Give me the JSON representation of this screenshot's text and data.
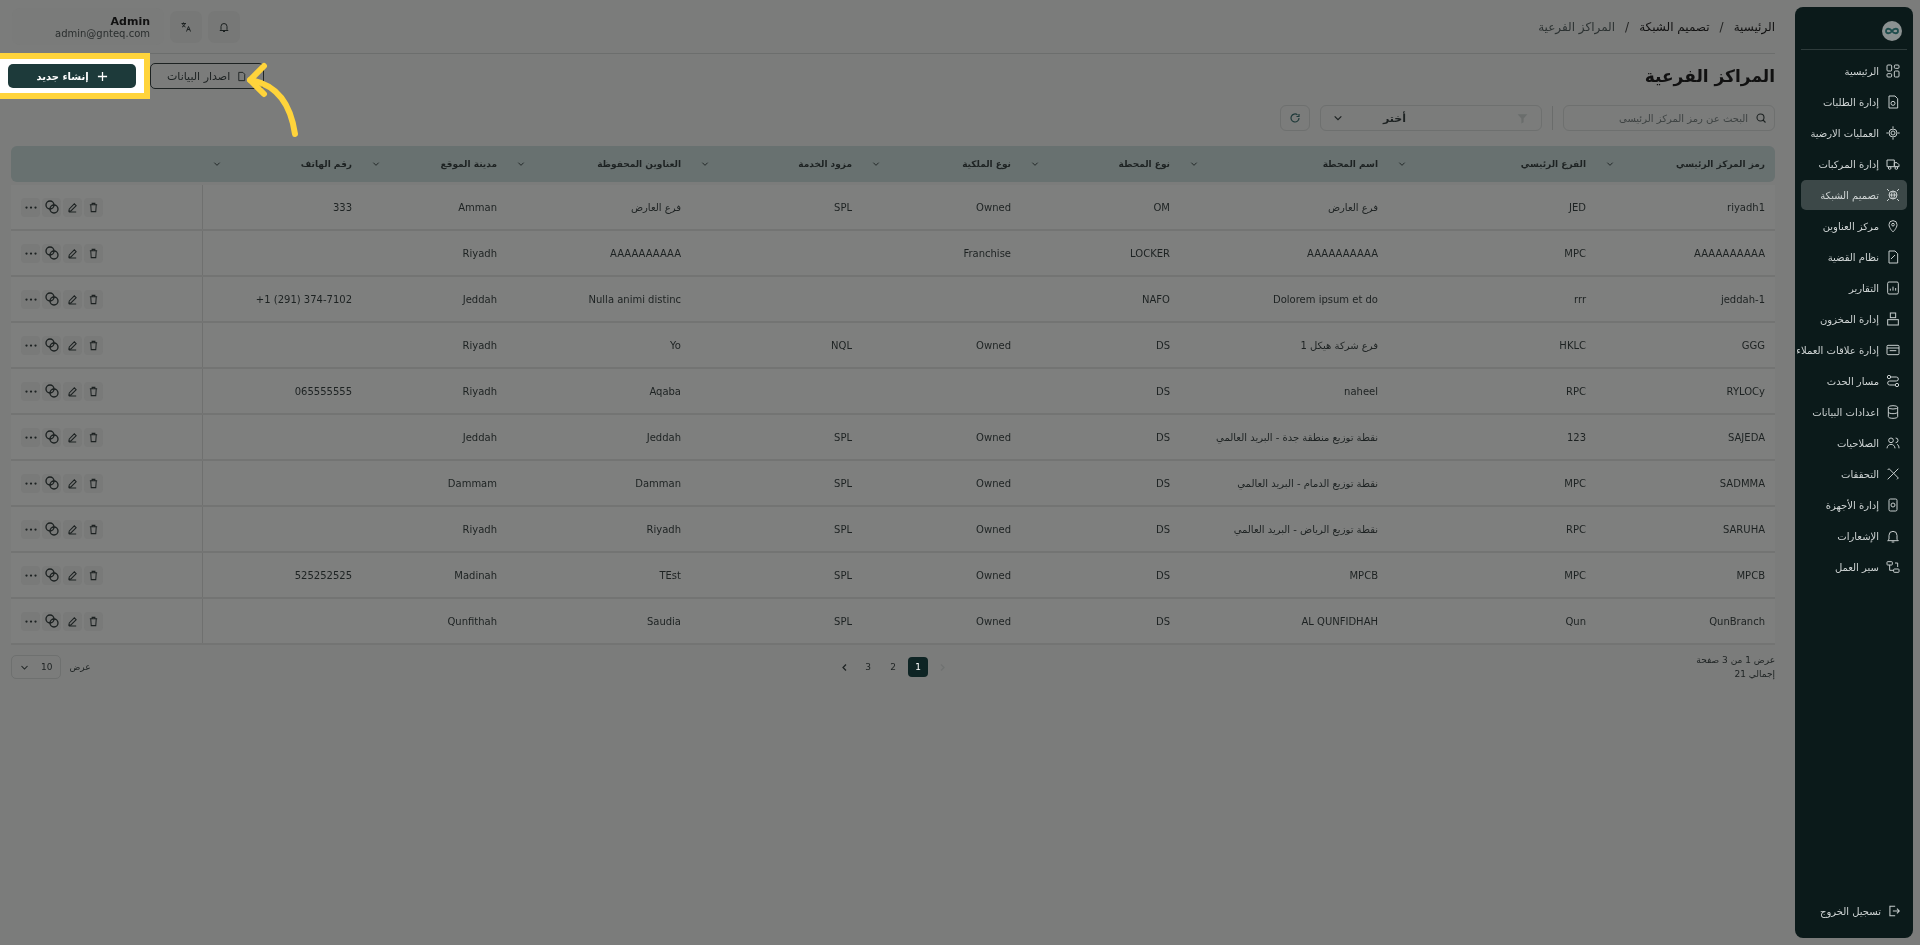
{
  "sidebar": {
    "items": [
      {
        "label": "الرئيسية",
        "selected": false
      },
      {
        "label": "إدارة الطلبات",
        "selected": false
      },
      {
        "label": "العمليات الارضية",
        "selected": false
      },
      {
        "label": "إدارة المركبات",
        "selected": false
      },
      {
        "label": "تصميم الشبكة",
        "selected": true
      },
      {
        "label": "مركز العناوين",
        "selected": false
      },
      {
        "label": "نظام القضية",
        "selected": false
      },
      {
        "label": "التقارير",
        "selected": false
      },
      {
        "label": "إدارة المخزون",
        "selected": false
      },
      {
        "label": "إدارة علاقات العملاء",
        "selected": false
      },
      {
        "label": "مسار الحدث",
        "selected": false
      },
      {
        "label": "اعدادات البيانات",
        "selected": false
      },
      {
        "label": "الصلاحيات",
        "selected": false
      },
      {
        "label": "التحققات",
        "selected": false
      },
      {
        "label": "إدارة الأجهزة",
        "selected": false
      },
      {
        "label": "الإشعارات",
        "selected": false
      },
      {
        "label": "سير العمل",
        "selected": false
      }
    ],
    "logout": "تسجيل الخروج"
  },
  "header": {
    "breadcrumb": [
      {
        "kind": "link",
        "label": "الرئيسية"
      },
      {
        "kind": "separator",
        "label": "/"
      },
      {
        "kind": "link",
        "label": "تصميم الشبكة"
      },
      {
        "kind": "separator",
        "label": "/"
      },
      {
        "kind": "current",
        "label": "المراكز الفرعية"
      }
    ],
    "user": {
      "name": "Admin",
      "email": "admin@gnteq.com"
    }
  },
  "page": {
    "title": "المراكز الفرعية",
    "export_button": "اصدار البيانات",
    "create_button": "إنشاء جديد",
    "search": {
      "placeholder": "البحث عن رمز المركز الرئيسي"
    },
    "filter": {
      "value": "أختر"
    }
  },
  "tutorial": {
    "spotlight": true
  },
  "table": {
    "columns": [
      "رمز المركز الرئيسي",
      "الفرع الرئيسي",
      "اسم المحطة",
      "نوع المحطة",
      "نوع الملكية",
      "مزود الخدمة",
      "العناوين المحفوظة",
      "مدينة الموقع",
      "رقم الهاتف"
    ],
    "rows": [
      {
        "code": "riyadh1",
        "branch": "JED",
        "station": "فرع العارض",
        "type": "OM",
        "ownership": "Owned",
        "provider": "SPL",
        "address": "فرع العارض",
        "city": "Amman",
        "phone": "333"
      },
      {
        "code": "AAAAAAAAAA",
        "branch": "MPC",
        "station": "AAAAAAAAAA",
        "type": "LOCKER",
        "ownership": "Franchise",
        "address": "AAAAAAAAAA",
        "city": "Riyadh"
      },
      {
        "code": "jeddah-1",
        "branch": "rrr",
        "station": "Dolorem ipsum et do",
        "type": "NAFO",
        "address": "Nulla animi distinc",
        "city": "Jeddah",
        "phone": "+1 (291) 374-7102"
      },
      {
        "code": "GGG",
        "branch": "HKLC",
        "station": "فرع شركة هيكل 1",
        "type": "DS",
        "ownership": "Owned",
        "provider": "NQL",
        "address": "Yo",
        "city": "Riyadh"
      },
      {
        "code": "RYLOCy",
        "branch": "RPC",
        "station": "naheel",
        "type": "DS",
        "address": "Aqaba",
        "city": "Riyadh",
        "phone": "065555555"
      },
      {
        "code": "SAJEDA",
        "branch": "123",
        "station": "نقطة توزيع منطقة جدة - البريد العالمي",
        "type": "DS",
        "ownership": "Owned",
        "provider": "SPL",
        "address": "Jeddah",
        "city": "Jeddah"
      },
      {
        "code": "SADMMA",
        "branch": "MPC",
        "station": "نقطة توزيع الدمام - البريد العالمي",
        "type": "DS",
        "ownership": "Owned",
        "provider": "SPL",
        "address": "Damman",
        "city": "Dammam"
      },
      {
        "code": "SARUHA",
        "branch": "RPC",
        "station": "نقطة توزيع الرياض - البريد العالمي",
        "type": "DS",
        "ownership": "Owned",
        "provider": "SPL",
        "address": "Riyadh",
        "city": "Riyadh"
      },
      {
        "code": "MPCB",
        "branch": "MPC",
        "station": "MPCB",
        "type": "DS",
        "ownership": "Owned",
        "provider": "SPL",
        "address": "TEst",
        "city": "Madinah",
        "phone": "525252525"
      },
      {
        "code": "QunBranch",
        "branch": "Qun",
        "station": "AL QUNFIDHAH",
        "type": "DS",
        "ownership": "Owned",
        "provider": "SPL",
        "address": "Saudia",
        "city": "Qunfithah"
      }
    ]
  },
  "pagination": {
    "summary": "عرض 1 من 3 صفحة",
    "total": "إجمالي 21",
    "prev": {
      "disabled": true
    },
    "next": {
      "disabled": false
    },
    "pages": [
      {
        "label": "1",
        "selected": true
      },
      {
        "label": "2",
        "selected": false
      },
      {
        "label": "3",
        "selected": false
      }
    ],
    "page_size": {
      "label": "عرض",
      "value": "10"
    }
  }
}
